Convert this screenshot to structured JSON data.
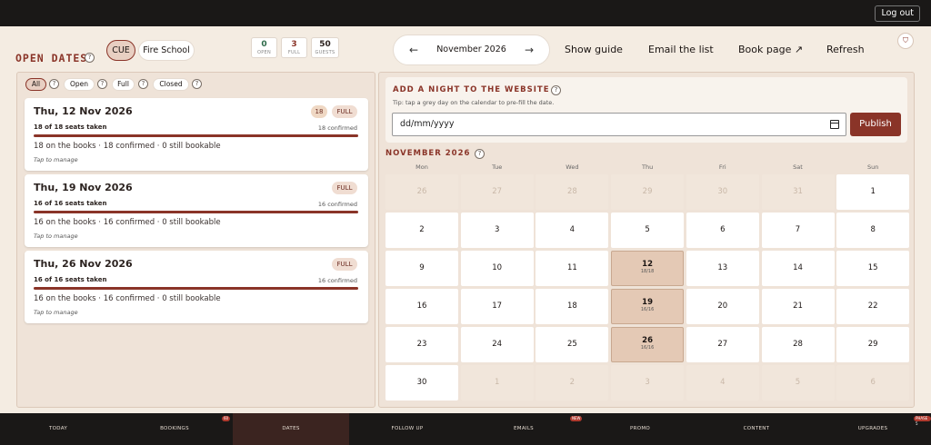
{
  "auth": {
    "logout_label": "Log out"
  },
  "header": {
    "title": "OPEN DATES",
    "help": "?",
    "sites": [
      {
        "label": "CUE",
        "active": true
      },
      {
        "label": "Fire School",
        "active": false
      }
    ],
    "stats": [
      {
        "value": "0",
        "label": "OPEN",
        "color": "#2e6b4a"
      },
      {
        "value": "3",
        "label": "FULL",
        "color": "#8a3428"
      },
      {
        "value": "50",
        "label": "GUESTS",
        "color": "#1b1513"
      }
    ],
    "month_nav": {
      "prev": "←",
      "month": "November 2026",
      "next": "→"
    },
    "links": [
      "Show guide",
      "Email the list",
      "Book page ↗",
      "Refresh"
    ],
    "shield_glyph": "⛉"
  },
  "filters": [
    {
      "label": "All",
      "active": true
    },
    {
      "label": "Open",
      "active": false
    },
    {
      "label": "Full",
      "active": false
    },
    {
      "label": "Closed",
      "active": false
    }
  ],
  "events": [
    {
      "date": "Thu, 12 Nov 2026",
      "guests_badge": "18",
      "status": "FULL",
      "seats": "18 of 18 seats taken",
      "confirmed": "18 confirmed",
      "fill": 1.0,
      "summary": "18 on the books · 18 confirmed · 0 still bookable",
      "tap": "Tap to manage"
    },
    {
      "date": "Thu, 19 Nov 2026",
      "guests_badge": "",
      "status": "FULL",
      "seats": "16 of 16 seats taken",
      "confirmed": "16 confirmed",
      "fill": 1.0,
      "summary": "16 on the books · 16 confirmed · 0 still bookable",
      "tap": "Tap to manage"
    },
    {
      "date": "Thu, 26 Nov 2026",
      "guests_badge": "",
      "status": "FULL",
      "seats": "16 of 16 seats taken",
      "confirmed": "16 confirmed",
      "fill": 1.0,
      "summary": "16 on the books · 16 confirmed · 0 still bookable",
      "tap": "Tap to manage"
    }
  ],
  "add_night": {
    "title": "ADD A NIGHT TO THE WEBSITE",
    "tip": "Tip: tap a grey day on the calendar to pre-fill the date.",
    "placeholder": "dd/mm/yyyy",
    "publish_label": "Publish"
  },
  "calendar": {
    "title": "NOVEMBER 2026",
    "weekdays": [
      "Mon",
      "Tue",
      "Wed",
      "Thu",
      "Fri",
      "Sat",
      "Sun"
    ],
    "days": [
      {
        "day": "26",
        "type": "out"
      },
      {
        "day": "27",
        "type": "out"
      },
      {
        "day": "28",
        "type": "out"
      },
      {
        "day": "29",
        "type": "out"
      },
      {
        "day": "30",
        "type": "out"
      },
      {
        "day": "31",
        "type": "out"
      },
      {
        "day": "1",
        "type": "in"
      },
      {
        "day": "2",
        "type": "in"
      },
      {
        "day": "3",
        "type": "in"
      },
      {
        "day": "4",
        "type": "in"
      },
      {
        "day": "5",
        "type": "in"
      },
      {
        "day": "6",
        "type": "in"
      },
      {
        "day": "7",
        "type": "in"
      },
      {
        "day": "8",
        "type": "in"
      },
      {
        "day": "9",
        "type": "in"
      },
      {
        "day": "10",
        "type": "in"
      },
      {
        "day": "11",
        "type": "in"
      },
      {
        "day": "12",
        "type": "book",
        "sub": "18/18"
      },
      {
        "day": "13",
        "type": "in"
      },
      {
        "day": "14",
        "type": "in"
      },
      {
        "day": "15",
        "type": "in"
      },
      {
        "day": "16",
        "type": "in"
      },
      {
        "day": "17",
        "type": "in"
      },
      {
        "day": "18",
        "type": "in"
      },
      {
        "day": "19",
        "type": "book",
        "sub": "16/16"
      },
      {
        "day": "20",
        "type": "in"
      },
      {
        "day": "21",
        "type": "in"
      },
      {
        "day": "22",
        "type": "in"
      },
      {
        "day": "23",
        "type": "in"
      },
      {
        "day": "24",
        "type": "in"
      },
      {
        "day": "25",
        "type": "in"
      },
      {
        "day": "26",
        "type": "book",
        "sub": "16/16"
      },
      {
        "day": "27",
        "type": "in"
      },
      {
        "day": "28",
        "type": "in"
      },
      {
        "day": "29",
        "type": "in"
      },
      {
        "day": "30",
        "type": "in"
      },
      {
        "day": "1",
        "type": "out"
      },
      {
        "day": "2",
        "type": "out"
      },
      {
        "day": "3",
        "type": "out"
      },
      {
        "day": "4",
        "type": "out"
      },
      {
        "day": "5",
        "type": "out"
      },
      {
        "day": "6",
        "type": "out"
      }
    ]
  },
  "bottom_nav": [
    {
      "label": "TODAY",
      "active": false,
      "pill": ""
    },
    {
      "label": "BOOKINGS",
      "active": false,
      "pill": "60"
    },
    {
      "label": "DATES",
      "active": true,
      "pill": ""
    },
    {
      "label": "FOLLOW UP",
      "active": false,
      "pill": ""
    },
    {
      "label": "EMAILS",
      "active": false,
      "pill": "NEW"
    },
    {
      "label": "PROMO",
      "active": false,
      "pill": ""
    },
    {
      "label": "CONTENT",
      "active": false,
      "pill": ""
    },
    {
      "label": "UPGRADES",
      "active": false,
      "pill": "PHASE 5"
    }
  ]
}
